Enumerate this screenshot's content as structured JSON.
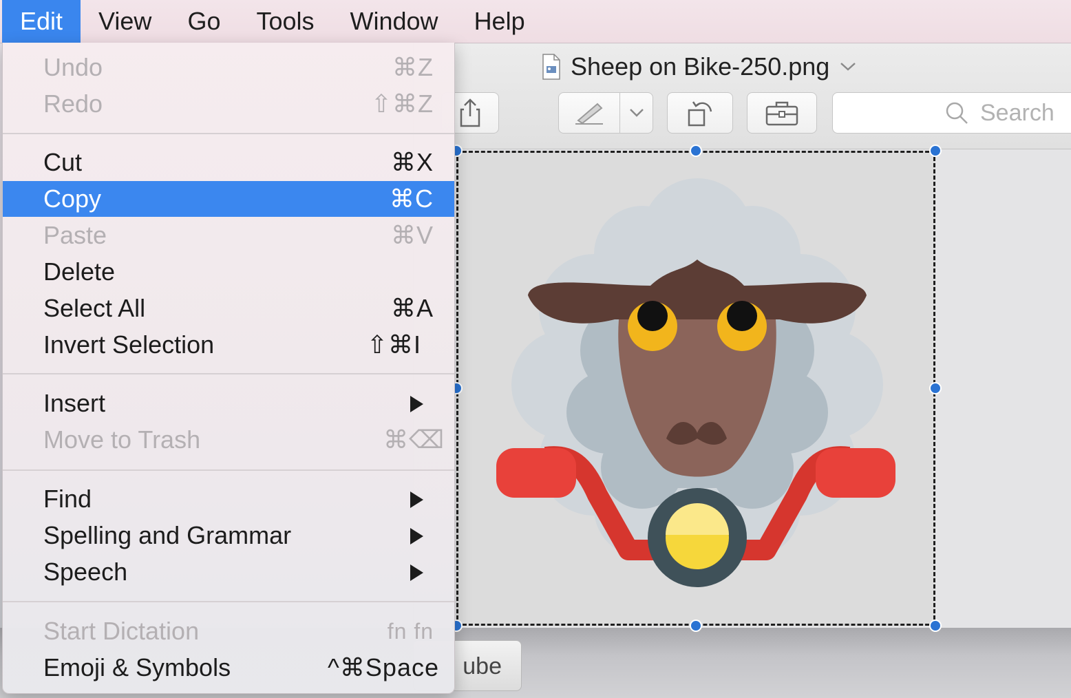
{
  "menubar": {
    "items": [
      {
        "label": "Edit",
        "active": true
      },
      {
        "label": "View"
      },
      {
        "label": "Go"
      },
      {
        "label": "Tools"
      },
      {
        "label": "Window"
      },
      {
        "label": "Help"
      }
    ]
  },
  "window": {
    "title": "Sheep on Bike-250.png",
    "search_placeholder": "Search",
    "behind_button_label": "ube"
  },
  "edit_menu": {
    "items": [
      {
        "label": "Undo",
        "shortcut": "⌘Z",
        "disabled": true
      },
      {
        "label": "Redo",
        "shortcut": "⇧⌘Z",
        "disabled": true
      },
      {
        "label": "Cut",
        "shortcut": "⌘X"
      },
      {
        "label": "Copy",
        "shortcut": "⌘C",
        "highlighted": true
      },
      {
        "label": "Paste",
        "shortcut": "⌘V",
        "disabled": true
      },
      {
        "label": "Delete",
        "shortcut": ""
      },
      {
        "label": "Select All",
        "shortcut": "⌘A"
      },
      {
        "label": "Invert Selection",
        "shortcut": "⇧⌘I"
      },
      {
        "label": "Insert",
        "submenu": true
      },
      {
        "label": "Move to Trash",
        "shortcut": "⌘⌫",
        "disabled": true
      },
      {
        "label": "Find",
        "submenu": true
      },
      {
        "label": "Spelling and Grammar",
        "submenu": true
      },
      {
        "label": "Speech",
        "submenu": true
      },
      {
        "label": "Start Dictation",
        "shortcut": "fn fn",
        "disabled": true
      },
      {
        "label": "Emoji & Symbols",
        "shortcut": "^⌘Space"
      }
    ]
  },
  "colors": {
    "accent": "#3b87ef",
    "handle": "#2a73d3",
    "sheep_wool": "#cfd5da",
    "sheep_face": "#8b645a",
    "sheep_ears": "#5c3d35",
    "sheep_eyes": "#f2b51c",
    "handlebar": "#d6362e",
    "headlight": "#fbe45a"
  }
}
